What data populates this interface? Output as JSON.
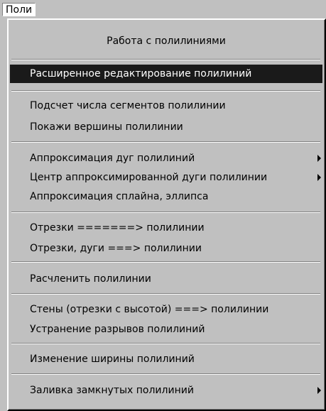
{
  "menubar": {
    "label": "Поли"
  },
  "menu": {
    "title": "Работа с полилиниями",
    "items": [
      "Расширенное редактирование полилиний",
      "Подсчет числа сегментов полилинии",
      "Покажи вершины полилинии",
      "Аппроксимация дуг полилиний",
      "Центр аппроксимированной дуги полилинии",
      "Аппроксимация сплайна, эллипса",
      "Отрезки =======> полилинии",
      "Отрезки, дуги ===> полилинии",
      "Расчленить полилинии",
      "Стены (отрезки с высотой) ===> полилинии",
      "Устранение разрывов полилиний",
      "Изменение ширины полилиний",
      "Заливка замкнутых полилиний"
    ]
  }
}
